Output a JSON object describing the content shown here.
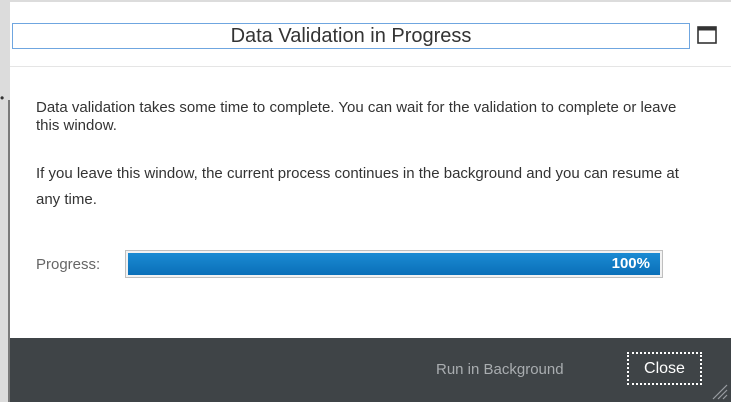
{
  "dialog": {
    "title": "Data Validation in Progress",
    "maximize_icon": "maximize-icon",
    "body": {
      "paragraph_1": "Data validation takes some time to complete. You can wait for the validation to complete or leave this window.",
      "paragraph_2": "If you leave this window, the current process continues in the background and you can resume at any time."
    },
    "progress": {
      "label": "Progress:",
      "value_text": "100%",
      "fraction": 1.0
    },
    "footer": {
      "run_in_background_label": "Run in Background",
      "close_label": "Close"
    }
  },
  "colors": {
    "progress_fill": "#0a6fb8",
    "footer_bg": "#3f4447",
    "title_border": "#6fa6e0"
  }
}
